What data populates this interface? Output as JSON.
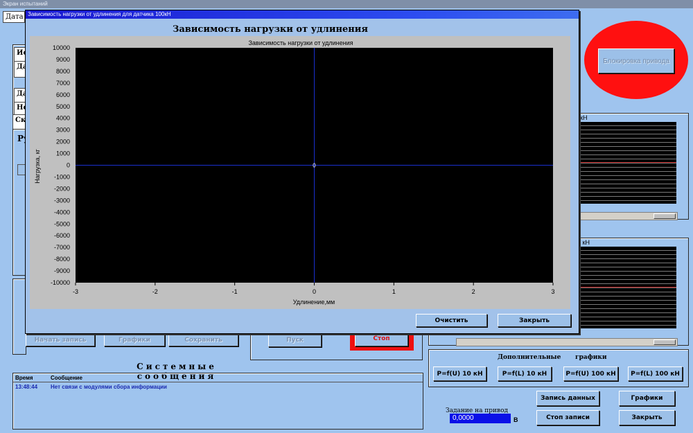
{
  "window": {
    "title": "Экран испытаний",
    "tab_label": "Дата"
  },
  "left_fragments": [
    "Ис",
    "Да",
    "Да",
    "Но",
    "Ско",
    "Ру"
  ],
  "left_disabled_buttons": [
    "Начать запись",
    "Графики",
    "Сохранить"
  ],
  "pusk_label": "Пуск",
  "stop_label": "Стоп",
  "system_messages": {
    "title": "Системные сообщения",
    "col_time": "Время",
    "col_message": "Сообщение",
    "rows": [
      {
        "time": "13:48:44",
        "message": "Нет связи с модулями сбора информации"
      }
    ]
  },
  "block_button_label": "Блокировка привода",
  "right_charts": [
    {
      "label": "кН"
    },
    {
      "label": "0 кН"
    }
  ],
  "additional": {
    "label_left": "Дополнительные",
    "label_right": "графики",
    "buttons": [
      "P=f(U) 10 кН",
      "P=f(L) 10 кН",
      "P=f(U) 100 кН",
      "P=f(L) 100 кН"
    ]
  },
  "drive": {
    "label": "Задание на привод",
    "value": "0,0000",
    "unit": "В"
  },
  "bottom_buttons": {
    "record": "Запись данных",
    "graphs": "Графики",
    "stop_record": "Стоп записи",
    "close": "Закрыть"
  },
  "dialog": {
    "title": "Зависимость нагрузки от удлинения для датчика 100кН",
    "heading": "Зависимость нагрузки от удлинения",
    "clear_label": "Очистить",
    "close_label": "Закрыть"
  },
  "chart_data": {
    "type": "scatter",
    "title": "Зависимость нагрузки от удлинения",
    "xlabel": "Удлинение,мм",
    "ylabel": "Нагрузка, кг",
    "xlim": [
      -3,
      3
    ],
    "ylim": [
      -10000,
      10000
    ],
    "x_ticks": [
      "-3",
      "-2",
      "-1",
      "0",
      "1",
      "2",
      "3"
    ],
    "y_ticks": [
      "10000",
      "9000",
      "8000",
      "7000",
      "6000",
      "5000",
      "4000",
      "3000",
      "2000",
      "1000",
      "0",
      "-1000",
      "-2000",
      "-3000",
      "-4000",
      "-5000",
      "-6000",
      "-7000",
      "-8000",
      "-9000",
      "-10000"
    ],
    "points": [
      {
        "x": 0,
        "y": 0,
        "label": "0"
      }
    ],
    "background": "#000000",
    "axis_color": "#1a2fd0",
    "grid": false
  },
  "colors": {
    "background": "#9fc4ee",
    "block_red": "#ff1010",
    "stop_frame": "#ee1010",
    "drive_value_bg": "#0a10e8"
  }
}
